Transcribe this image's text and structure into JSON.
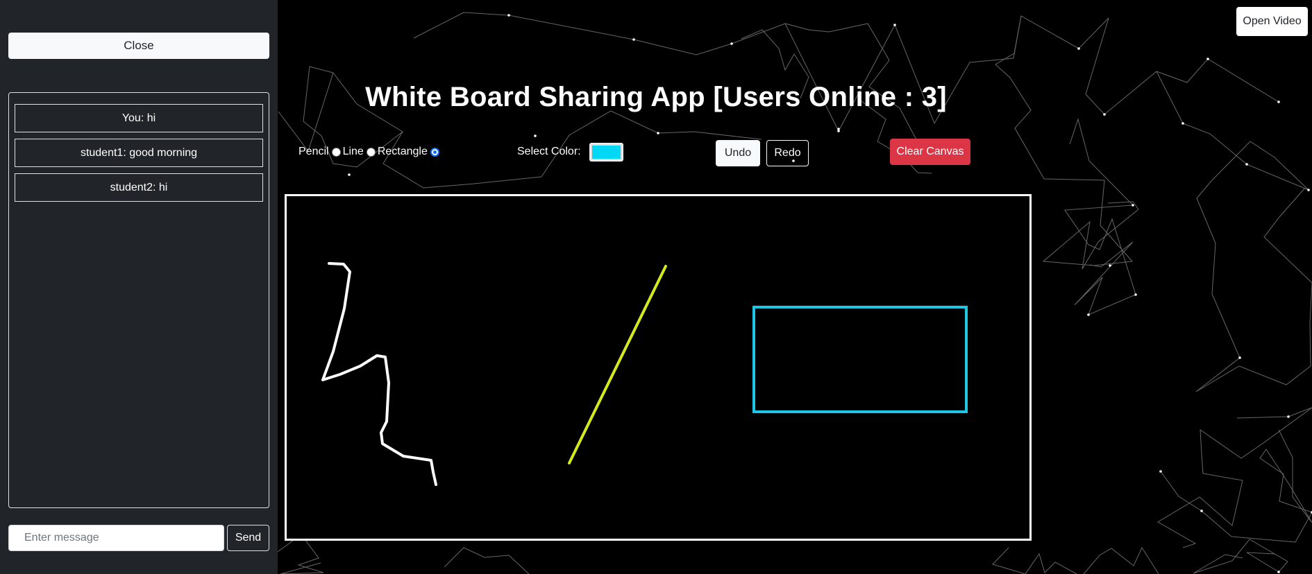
{
  "sidebar": {
    "close_label": "Close",
    "messages": [
      {
        "text": "You: hi"
      },
      {
        "text": "student1: good morning"
      },
      {
        "text": "student2: hi"
      }
    ],
    "input_placeholder": "Enter message",
    "input_value": "",
    "send_label": "Send"
  },
  "header": {
    "title": "White Board Sharing App [Users Online : 3]",
    "open_video_label": "Open Video"
  },
  "toolbar": {
    "tools": [
      {
        "label": "Pencil",
        "selected": false
      },
      {
        "label": "Line",
        "selected": false
      },
      {
        "label": "Rectangle",
        "selected": true
      }
    ],
    "select_color_label": "Select Color:",
    "selected_color": "#00d8f5",
    "undo_label": "Undo",
    "redo_label": "Redo",
    "clear_label": "Clear Canvas"
  },
  "colors": {
    "sidebar_bg": "#212529",
    "danger": "#dc3545",
    "pencil_stroke": "#ffffff",
    "line_stroke": "#d4ea1a",
    "rect_stroke": "#1ec6e6"
  }
}
